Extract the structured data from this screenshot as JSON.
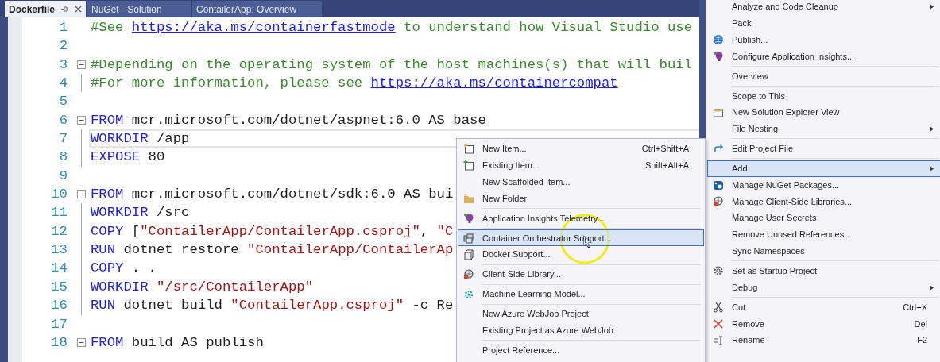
{
  "tabs": [
    {
      "label": "Dockerfile",
      "selected": true
    },
    {
      "label": "NuGet - Solution",
      "selected": false
    },
    {
      "label": "ContailerApp: Overview",
      "selected": false
    }
  ],
  "editor": {
    "lines": [
      {
        "number": "1",
        "tokens": [
          {
            "kind": "comment",
            "text": "#See "
          },
          {
            "kind": "link",
            "text": "https://aka.ms/containerfastmode"
          },
          {
            "kind": "comment",
            "text": " to understand how Visual Studio use"
          }
        ]
      },
      {
        "number": "2"
      },
      {
        "number": "3",
        "fold": true,
        "tokens": [
          {
            "kind": "comment",
            "text": "#Depending on the operating system of the host machines(s) that will buil"
          }
        ]
      },
      {
        "number": "4",
        "tokens": [
          {
            "kind": "comment",
            "text": "#For more information, please see "
          },
          {
            "kind": "link",
            "text": "https://aka.ms/containercompat"
          }
        ]
      },
      {
        "number": "5"
      },
      {
        "number": "6",
        "fold": true,
        "tokens": [
          {
            "kind": "keyword",
            "text": "FROM"
          },
          {
            "kind": "plain",
            "text": " mcr.microsoft.com/dotnet/aspnet:6.0 AS base"
          }
        ]
      },
      {
        "number": "7",
        "current": true,
        "tokens": [
          {
            "kind": "keyword",
            "text": "WORKDIR"
          },
          {
            "kind": "plain",
            "text": " /app"
          }
        ]
      },
      {
        "number": "8",
        "tokens": [
          {
            "kind": "keyword",
            "text": "EXPOSE"
          },
          {
            "kind": "plain",
            "text": " 80"
          }
        ]
      },
      {
        "number": "9"
      },
      {
        "number": "10",
        "fold": true,
        "tokens": [
          {
            "kind": "keyword",
            "text": "FROM"
          },
          {
            "kind": "plain",
            "text": " mcr.microsoft.com/dotnet/sdk:6.0 AS bui"
          }
        ]
      },
      {
        "number": "11",
        "tokens": [
          {
            "kind": "keyword",
            "text": "WORKDIR"
          },
          {
            "kind": "plain",
            "text": " /src"
          }
        ]
      },
      {
        "number": "12",
        "tokens": [
          {
            "kind": "keyword",
            "text": "COPY"
          },
          {
            "kind": "plain",
            "text": " ["
          },
          {
            "kind": "string",
            "text": "\"ContailerApp/ContailerApp.csproj\""
          },
          {
            "kind": "plain",
            "text": ", "
          },
          {
            "kind": "string",
            "text": "\"C"
          }
        ]
      },
      {
        "number": "13",
        "tokens": [
          {
            "kind": "keyword",
            "text": "RUN"
          },
          {
            "kind": "plain",
            "text": " dotnet restore "
          },
          {
            "kind": "string",
            "text": "\"ContailerApp/ContailerAp"
          }
        ]
      },
      {
        "number": "14",
        "tokens": [
          {
            "kind": "keyword",
            "text": "COPY"
          },
          {
            "kind": "plain",
            "text": " . ."
          }
        ]
      },
      {
        "number": "15",
        "tokens": [
          {
            "kind": "keyword",
            "text": "WORKDIR"
          },
          {
            "kind": "string",
            "text": " \"/src/ContailerApp\""
          }
        ]
      },
      {
        "number": "16",
        "tokens": [
          {
            "kind": "keyword",
            "text": "RUN"
          },
          {
            "kind": "plain",
            "text": " dotnet build "
          },
          {
            "kind": "string",
            "text": "\"ContailerApp.csproj\""
          },
          {
            "kind": "plain",
            "text": " -c Re"
          }
        ]
      },
      {
        "number": "17"
      },
      {
        "number": "18",
        "fold": true,
        "tokens": [
          {
            "kind": "keyword",
            "text": "FROM"
          },
          {
            "kind": "plain",
            "text": " build AS publish"
          }
        ]
      }
    ]
  },
  "context_menu": {
    "items": [
      {
        "kind": "item",
        "label": "Analyze and Code Cleanup",
        "submenu": true,
        "selected": false
      },
      {
        "kind": "item",
        "label": "Pack",
        "selected": false
      },
      {
        "kind": "item",
        "label": "Publish...",
        "selected": false
      },
      {
        "kind": "item",
        "label": "Configure Application Insights...",
        "selected": false
      },
      {
        "kind": "separator"
      },
      {
        "kind": "item",
        "label": "Overview",
        "selected": false
      },
      {
        "kind": "separator"
      },
      {
        "kind": "item",
        "label": "Scope to This",
        "selected": false
      },
      {
        "kind": "item",
        "label": "New Solution Explorer View",
        "selected": false
      },
      {
        "kind": "item",
        "label": "File Nesting",
        "submenu": true,
        "selected": false
      },
      {
        "kind": "separator"
      },
      {
        "kind": "item",
        "label": "Edit Project File",
        "selected": false
      },
      {
        "kind": "separator"
      },
      {
        "kind": "item",
        "label": "Add",
        "submenu": true,
        "selected": true
      },
      {
        "kind": "item",
        "label": "Manage NuGet Packages...",
        "selected": false
      },
      {
        "kind": "item",
        "label": "Manage Client-Side Libraries...",
        "selected": false
      },
      {
        "kind": "item",
        "label": "Manage User Secrets",
        "selected": false
      },
      {
        "kind": "item",
        "label": "Remove Unused References...",
        "selected": false
      },
      {
        "kind": "item",
        "label": "Sync Namespaces",
        "selected": false
      },
      {
        "kind": "separator"
      },
      {
        "kind": "item",
        "label": "Set as Startup Project",
        "selected": false
      },
      {
        "kind": "item",
        "label": "Debug",
        "submenu": true,
        "selected": false
      },
      {
        "kind": "separator"
      },
      {
        "kind": "item",
        "label": "Cut",
        "shortcut": "Ctrl+X",
        "selected": false
      },
      {
        "kind": "item",
        "label": "Remove",
        "shortcut": "Del",
        "selected": false
      },
      {
        "kind": "item",
        "label": "Rename",
        "shortcut": "F2",
        "selected": false
      }
    ]
  },
  "add_submenu": {
    "items": [
      {
        "kind": "item",
        "label": "New Item...",
        "shortcut": "Ctrl+Shift+A",
        "selected": false
      },
      {
        "kind": "item",
        "label": "Existing Item...",
        "shortcut": "Shift+Alt+A",
        "selected": false
      },
      {
        "kind": "item",
        "label": "New Scaffolded Item...",
        "selected": false
      },
      {
        "kind": "item",
        "label": "New Folder",
        "selected": false
      },
      {
        "kind": "separator"
      },
      {
        "kind": "item",
        "label": "Application Insights Telemetry...",
        "selected": false
      },
      {
        "kind": "separator"
      },
      {
        "kind": "item",
        "label": "Container Orchestrator Support...",
        "selected": true
      },
      {
        "kind": "item",
        "label": "Docker Support...",
        "selected": false
      },
      {
        "kind": "separator"
      },
      {
        "kind": "item",
        "label": "Client-Side Library...",
        "selected": false
      },
      {
        "kind": "separator"
      },
      {
        "kind": "item",
        "label": "Machine Learning Model...",
        "selected": false
      },
      {
        "kind": "separator"
      },
      {
        "kind": "item",
        "label": "New Azure WebJob Project",
        "selected": false
      },
      {
        "kind": "item",
        "label": "Existing Project as Azure WebJob",
        "selected": false
      },
      {
        "kind": "separator"
      },
      {
        "kind": "item",
        "label": "Project Reference...",
        "selected": false
      }
    ]
  }
}
